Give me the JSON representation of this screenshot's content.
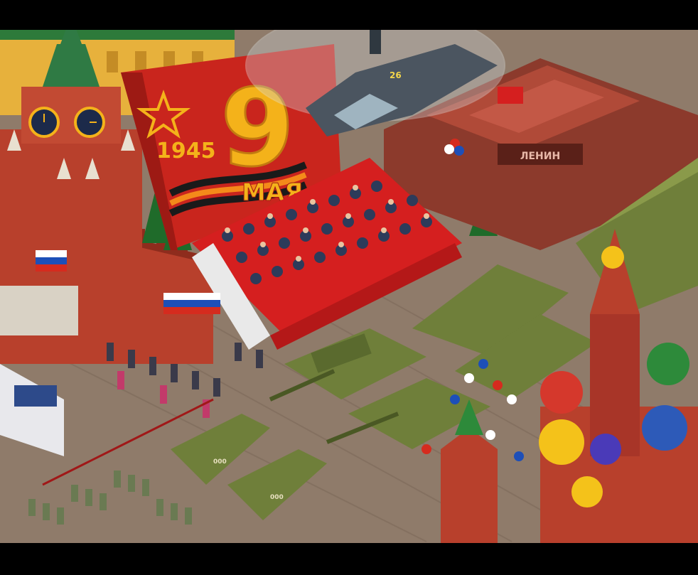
{
  "scene": {
    "title": "Victory Day parade on Red Square (pixel art)",
    "banner": {
      "year": "1945",
      "day": "9",
      "month": "МАЯ"
    },
    "mausoleum_sign": "ЛЕНИН",
    "helicopter_number": "26",
    "vehicle_number": "000",
    "colors": {
      "letterbox": "#000000",
      "banner_red": "#c9251d",
      "banner_gold": "#f4b21a",
      "kremlin_brick": "#b8402c",
      "square_paving": "#8f7b6a",
      "mausoleum": "#8c3a2c",
      "military_green": "#6f7f3a",
      "carpet_red": "#d51f1f",
      "tree_green": "#1f6b2a"
    },
    "icons": [
      "star-icon",
      "clock-icon",
      "flag-icon",
      "helicopter-icon",
      "tank-icon",
      "balloon-icon"
    ]
  }
}
